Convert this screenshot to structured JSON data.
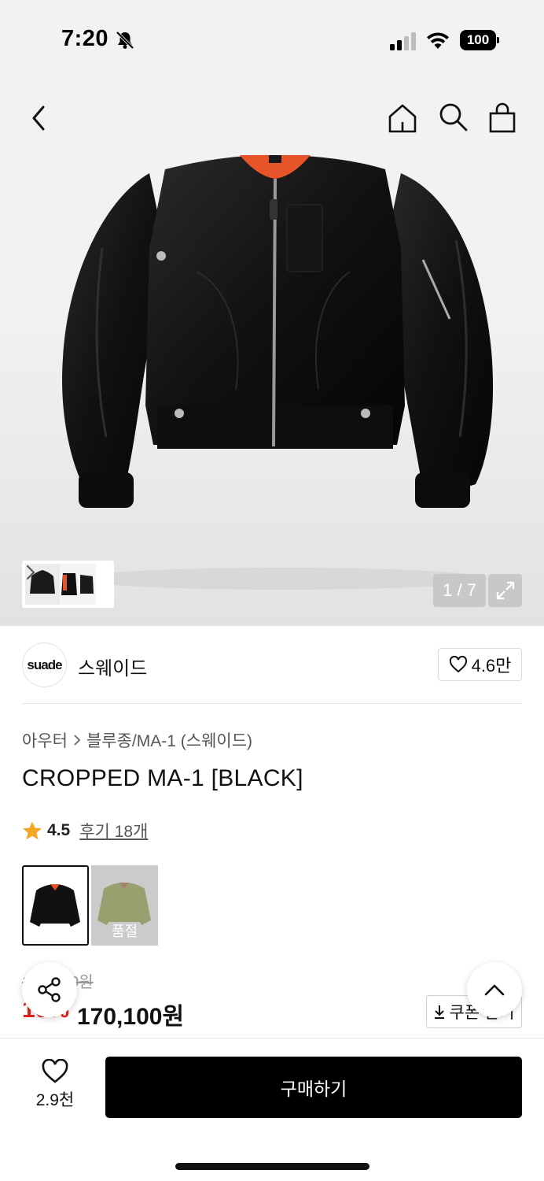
{
  "status_bar": {
    "time": "7:20",
    "battery": "100"
  },
  "gallery": {
    "counter": "1 / 7"
  },
  "brand": {
    "logo_text": "suade",
    "name": "스웨이드",
    "likes": "4.6만"
  },
  "breadcrumb": {
    "category": "아우터",
    "subcategory": "블루종/MA-1 (스웨이드)"
  },
  "product": {
    "title": "CROPPED MA-1 [BLACK]",
    "rating": "4.5",
    "reviews": "후기 18개"
  },
  "colors": [
    {
      "name": "black",
      "sold_out": false
    },
    {
      "name": "khaki",
      "sold_out": true,
      "label": "품절"
    }
  ],
  "price": {
    "original": "189,000원",
    "discount": "10%",
    "sale": "170,100원",
    "coupon_label": "쿠폰 받기"
  },
  "bottom_bar": {
    "wishlist_count": "2.9천",
    "buy_label": "구매하기"
  },
  "colors_theme": {
    "accent_red": "#e2231a",
    "star": "#f5a623",
    "lining_orange": "#e8542a"
  }
}
